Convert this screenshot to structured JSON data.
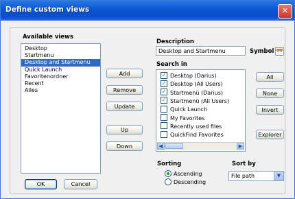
{
  "window": {
    "title": "Define custom views",
    "close_glyph": "✕"
  },
  "available_views": {
    "label": "Available views",
    "items": [
      {
        "label": "Desktop",
        "selected": false
      },
      {
        "label": "Startmenu",
        "selected": false
      },
      {
        "label": "Desktop and Startmenu",
        "selected": true
      },
      {
        "label": "Quick Launch",
        "selected": false
      },
      {
        "label": "Favoritenordner",
        "selected": false
      },
      {
        "label": "Recent",
        "selected": false
      },
      {
        "label": "Alles",
        "selected": false
      }
    ]
  },
  "middle_buttons": {
    "add": "Add",
    "remove": "Remove",
    "update": "Update",
    "up": "Up",
    "down": "Down"
  },
  "description": {
    "label": "Description",
    "value": "Desktop and Startmenu"
  },
  "symbol": {
    "label": "Symbol",
    "icon": "calendar-icon"
  },
  "search_in": {
    "label": "Search in",
    "items": [
      {
        "label": "Desktop (Darius)",
        "checked": true
      },
      {
        "label": "Desktop (All Users)",
        "checked": true
      },
      {
        "label": "Startmenü (Darius)",
        "checked": true
      },
      {
        "label": "Startmenü (All Users)",
        "checked": true
      },
      {
        "label": "Quick Launch",
        "checked": false
      },
      {
        "label": "My Favorites",
        "checked": false
      },
      {
        "label": "Recently used files",
        "checked": false
      },
      {
        "label": "QuickFind Favorites",
        "checked": false
      }
    ]
  },
  "right_buttons": {
    "all": "All",
    "none": "None",
    "invert": "Invert",
    "explorer": "Explorer"
  },
  "sorting": {
    "label": "Sorting",
    "options": [
      {
        "label": "Ascending",
        "selected": true
      },
      {
        "label": "Descending",
        "selected": false
      }
    ]
  },
  "sort_by": {
    "label": "Sort by",
    "value": "File path"
  },
  "footer": {
    "ok": "OK",
    "cancel": "Cancel"
  },
  "colors": {
    "titlebar": "#0b55d2",
    "selection": "#316ac5",
    "check": "#21a121"
  }
}
